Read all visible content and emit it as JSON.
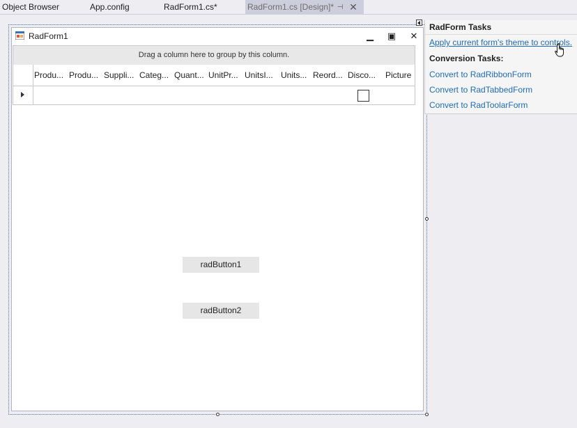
{
  "tabs": [
    {
      "label": "Object Browser",
      "active": false
    },
    {
      "label": "App.config",
      "active": false
    },
    {
      "label": "RadForm1.cs*",
      "active": false
    },
    {
      "label": "RadForm1.cs [Design]*",
      "active": true
    }
  ],
  "tab_icons": {
    "pin": "pin-icon",
    "close": "close-icon"
  },
  "form": {
    "title": "RadForm1",
    "icon": "form-icon",
    "caption_buttons": {
      "minimize": "minimize-icon",
      "maximize": "maximize-icon",
      "close": "close-icon"
    }
  },
  "grid": {
    "group_panel_text": "Drag a column here to group by this column.",
    "columns": [
      "Produ...",
      "Produ...",
      "Suppli...",
      "Categ...",
      "Quant...",
      "UnitPr...",
      "UnitsI...",
      "Units...",
      "Reord...",
      "Disco...",
      "Picture"
    ],
    "row_indicator_icon": "row-arrow-icon",
    "new_row_discontinued_checked": false
  },
  "buttons": {
    "button1": "radButton1",
    "button2": "radButton2"
  },
  "tasks_panel": {
    "title": "RadForm Tasks",
    "apply_theme_link": "Apply current form's theme to controls.",
    "conversion_title": "Conversion Tasks:",
    "convert_links": [
      "Convert to RadRibbonForm",
      "Convert to RadTabbedForm",
      "Convert to RadToolarForm"
    ]
  },
  "colors": {
    "link": "#1f6bb5",
    "active_tab": "#cccedb",
    "designer_bg": "#eeeef2"
  }
}
